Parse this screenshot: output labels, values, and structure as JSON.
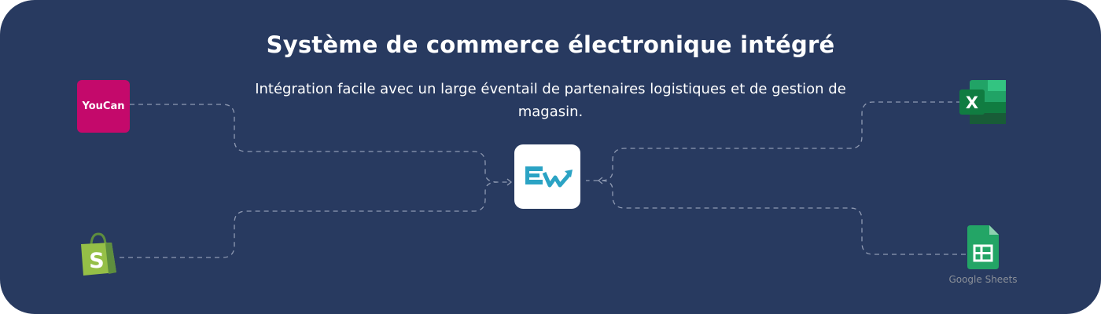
{
  "header": {
    "title": "Système de commerce électronique intégré",
    "subtitle": "Intégration facile avec un large éventail de partenaires logistiques et de gestion de magasin."
  },
  "partners": {
    "youcan": {
      "label": "YouCan",
      "icon": "youcan-logo"
    },
    "shopify": {
      "icon": "shopify-bag-icon",
      "letter": "S"
    },
    "excel": {
      "icon": "excel-icon",
      "letter": "X"
    },
    "google_sheets": {
      "icon": "google-sheets-icon",
      "label": "Google Sheets"
    }
  },
  "hub": {
    "icon": "ew-logo",
    "letters": "EW"
  },
  "colors": {
    "background": "#283a60",
    "youcan": "#c4096b",
    "shopify": "#95bf47",
    "excel": "#21a366",
    "sheets": "#23a566",
    "hub_logo": "#2ba3c4",
    "connector": "#8f9ab2"
  }
}
